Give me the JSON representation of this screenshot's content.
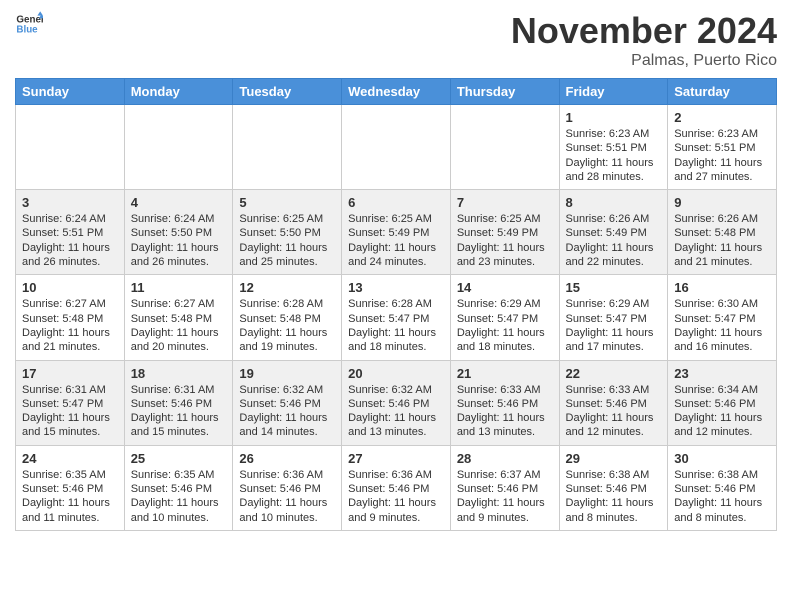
{
  "header": {
    "logo_general": "General",
    "logo_blue": "Blue",
    "month_title": "November 2024",
    "location": "Palmas, Puerto Rico"
  },
  "weekdays": [
    "Sunday",
    "Monday",
    "Tuesday",
    "Wednesday",
    "Thursday",
    "Friday",
    "Saturday"
  ],
  "weeks": [
    [
      {
        "day": "",
        "info": ""
      },
      {
        "day": "",
        "info": ""
      },
      {
        "day": "",
        "info": ""
      },
      {
        "day": "",
        "info": ""
      },
      {
        "day": "",
        "info": ""
      },
      {
        "day": "1",
        "info": "Sunrise: 6:23 AM\nSunset: 5:51 PM\nDaylight: 11 hours and 28 minutes."
      },
      {
        "day": "2",
        "info": "Sunrise: 6:23 AM\nSunset: 5:51 PM\nDaylight: 11 hours and 27 minutes."
      }
    ],
    [
      {
        "day": "3",
        "info": "Sunrise: 6:24 AM\nSunset: 5:51 PM\nDaylight: 11 hours and 26 minutes."
      },
      {
        "day": "4",
        "info": "Sunrise: 6:24 AM\nSunset: 5:50 PM\nDaylight: 11 hours and 26 minutes."
      },
      {
        "day": "5",
        "info": "Sunrise: 6:25 AM\nSunset: 5:50 PM\nDaylight: 11 hours and 25 minutes."
      },
      {
        "day": "6",
        "info": "Sunrise: 6:25 AM\nSunset: 5:49 PM\nDaylight: 11 hours and 24 minutes."
      },
      {
        "day": "7",
        "info": "Sunrise: 6:25 AM\nSunset: 5:49 PM\nDaylight: 11 hours and 23 minutes."
      },
      {
        "day": "8",
        "info": "Sunrise: 6:26 AM\nSunset: 5:49 PM\nDaylight: 11 hours and 22 minutes."
      },
      {
        "day": "9",
        "info": "Sunrise: 6:26 AM\nSunset: 5:48 PM\nDaylight: 11 hours and 21 minutes."
      }
    ],
    [
      {
        "day": "10",
        "info": "Sunrise: 6:27 AM\nSunset: 5:48 PM\nDaylight: 11 hours and 21 minutes."
      },
      {
        "day": "11",
        "info": "Sunrise: 6:27 AM\nSunset: 5:48 PM\nDaylight: 11 hours and 20 minutes."
      },
      {
        "day": "12",
        "info": "Sunrise: 6:28 AM\nSunset: 5:48 PM\nDaylight: 11 hours and 19 minutes."
      },
      {
        "day": "13",
        "info": "Sunrise: 6:28 AM\nSunset: 5:47 PM\nDaylight: 11 hours and 18 minutes."
      },
      {
        "day": "14",
        "info": "Sunrise: 6:29 AM\nSunset: 5:47 PM\nDaylight: 11 hours and 18 minutes."
      },
      {
        "day": "15",
        "info": "Sunrise: 6:29 AM\nSunset: 5:47 PM\nDaylight: 11 hours and 17 minutes."
      },
      {
        "day": "16",
        "info": "Sunrise: 6:30 AM\nSunset: 5:47 PM\nDaylight: 11 hours and 16 minutes."
      }
    ],
    [
      {
        "day": "17",
        "info": "Sunrise: 6:31 AM\nSunset: 5:47 PM\nDaylight: 11 hours and 15 minutes."
      },
      {
        "day": "18",
        "info": "Sunrise: 6:31 AM\nSunset: 5:46 PM\nDaylight: 11 hours and 15 minutes."
      },
      {
        "day": "19",
        "info": "Sunrise: 6:32 AM\nSunset: 5:46 PM\nDaylight: 11 hours and 14 minutes."
      },
      {
        "day": "20",
        "info": "Sunrise: 6:32 AM\nSunset: 5:46 PM\nDaylight: 11 hours and 13 minutes."
      },
      {
        "day": "21",
        "info": "Sunrise: 6:33 AM\nSunset: 5:46 PM\nDaylight: 11 hours and 13 minutes."
      },
      {
        "day": "22",
        "info": "Sunrise: 6:33 AM\nSunset: 5:46 PM\nDaylight: 11 hours and 12 minutes."
      },
      {
        "day": "23",
        "info": "Sunrise: 6:34 AM\nSunset: 5:46 PM\nDaylight: 11 hours and 12 minutes."
      }
    ],
    [
      {
        "day": "24",
        "info": "Sunrise: 6:35 AM\nSunset: 5:46 PM\nDaylight: 11 hours and 11 minutes."
      },
      {
        "day": "25",
        "info": "Sunrise: 6:35 AM\nSunset: 5:46 PM\nDaylight: 11 hours and 10 minutes."
      },
      {
        "day": "26",
        "info": "Sunrise: 6:36 AM\nSunset: 5:46 PM\nDaylight: 11 hours and 10 minutes."
      },
      {
        "day": "27",
        "info": "Sunrise: 6:36 AM\nSunset: 5:46 PM\nDaylight: 11 hours and 9 minutes."
      },
      {
        "day": "28",
        "info": "Sunrise: 6:37 AM\nSunset: 5:46 PM\nDaylight: 11 hours and 9 minutes."
      },
      {
        "day": "29",
        "info": "Sunrise: 6:38 AM\nSunset: 5:46 PM\nDaylight: 11 hours and 8 minutes."
      },
      {
        "day": "30",
        "info": "Sunrise: 6:38 AM\nSunset: 5:46 PM\nDaylight: 11 hours and 8 minutes."
      }
    ]
  ]
}
